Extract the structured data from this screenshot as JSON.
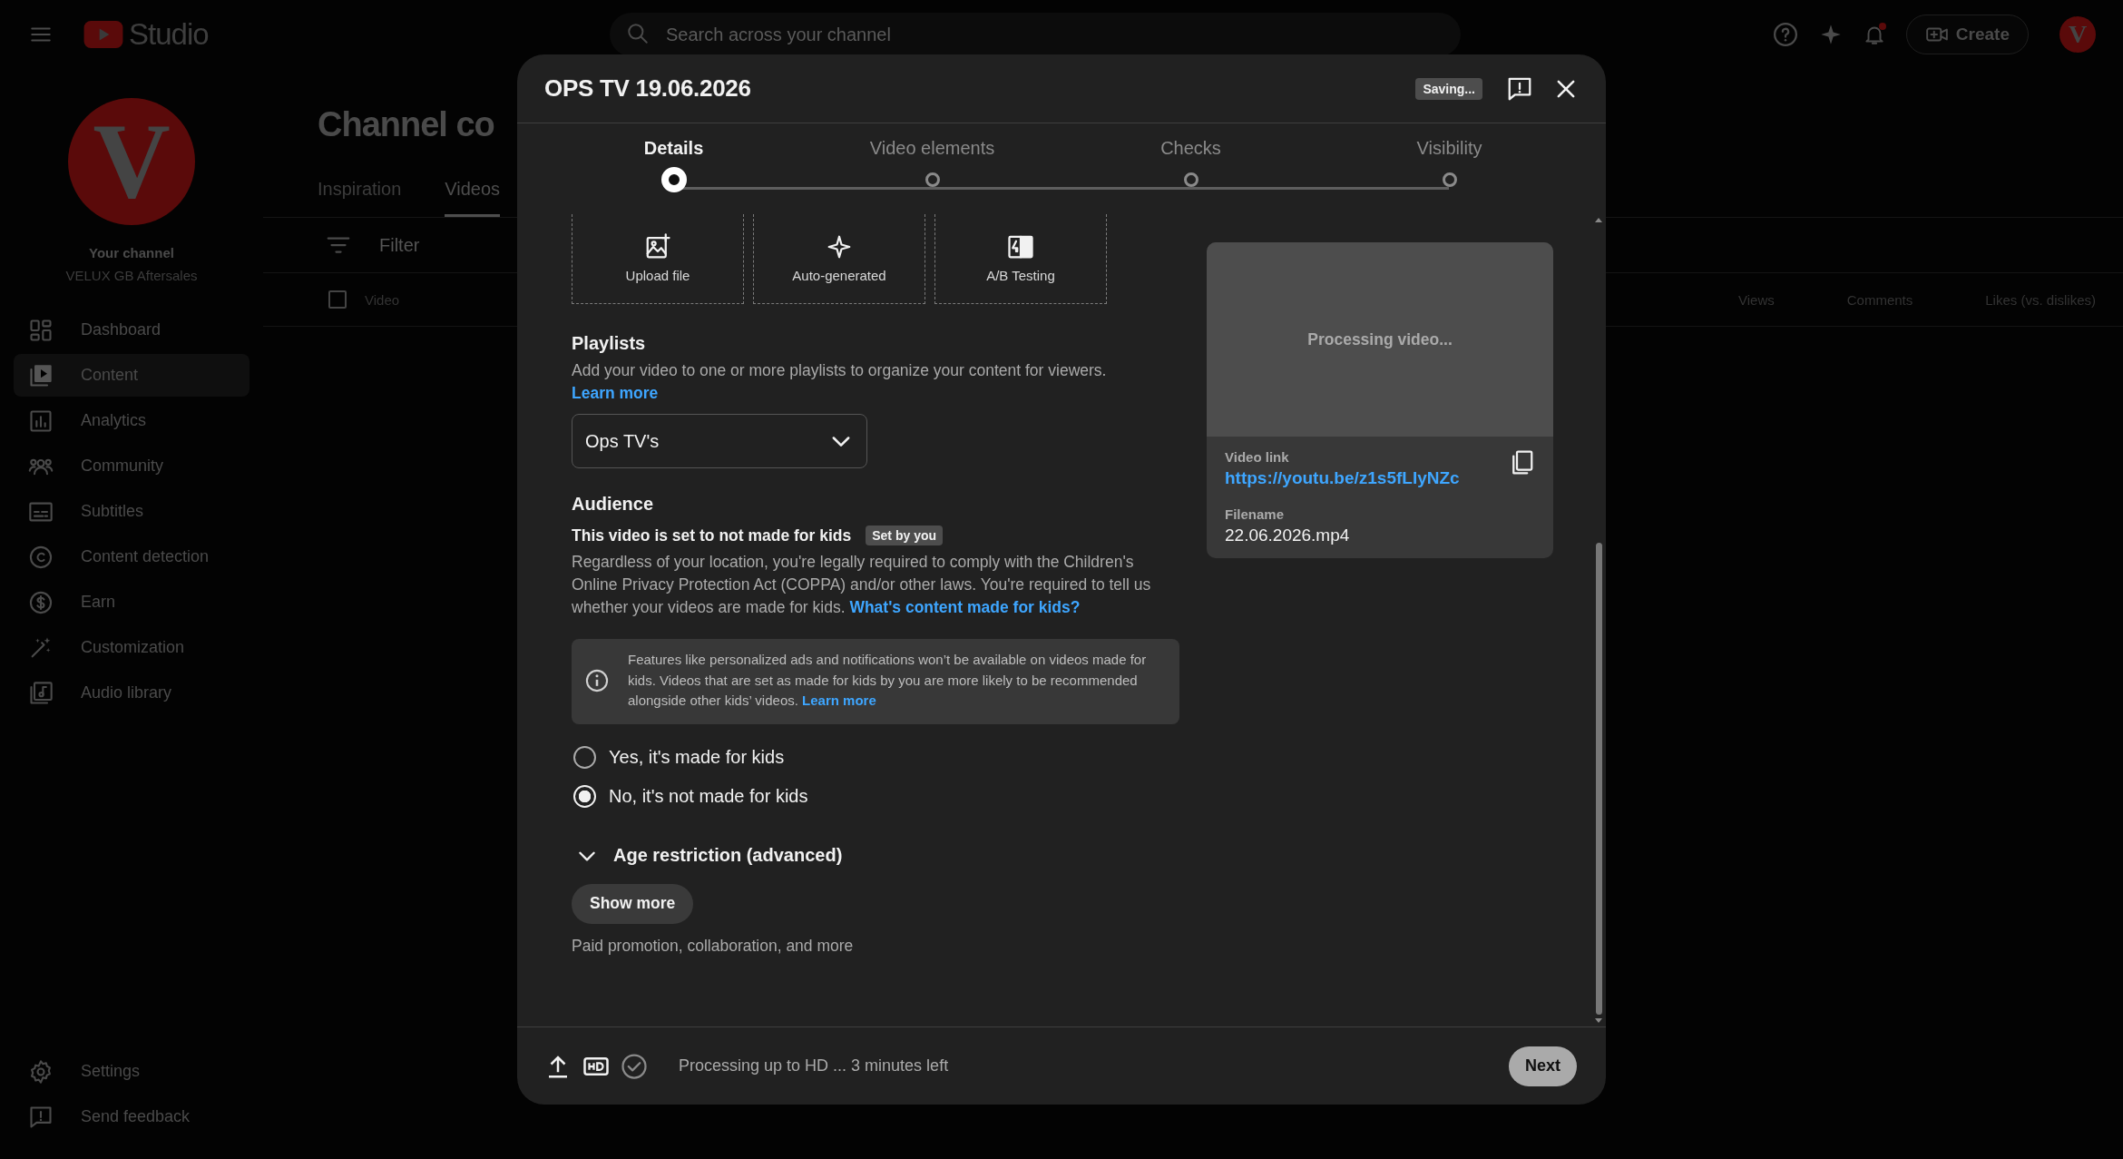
{
  "app": {
    "logo": "Studio",
    "search": {
      "placeholder": "Search across your channel"
    },
    "create_button": "Create",
    "avatar": "V"
  },
  "sidebar": {
    "avatar": "V",
    "channel_label": "Your channel",
    "channel_name": "VELUX GB Aftersales",
    "items": [
      {
        "label": "Dashboard",
        "selected": false
      },
      {
        "label": "Content",
        "selected": true
      },
      {
        "label": "Analytics",
        "selected": false
      },
      {
        "label": "Community",
        "selected": false
      },
      {
        "label": "Subtitles",
        "selected": false
      },
      {
        "label": "Content detection",
        "selected": false
      },
      {
        "label": "Earn",
        "selected": false
      },
      {
        "label": "Customization",
        "selected": false
      },
      {
        "label": "Audio library",
        "selected": false
      }
    ],
    "footer_items": [
      {
        "label": "Settings"
      },
      {
        "label": "Send feedback"
      }
    ]
  },
  "page": {
    "title": "Channel co",
    "tabs": [
      {
        "label": "Inspiration",
        "selected": false
      },
      {
        "label": "Videos",
        "selected": true
      }
    ],
    "filter": {
      "placeholder": "Filter"
    },
    "select_all": {
      "checked": false
    },
    "columns": [
      "Video",
      "Views",
      "Comments",
      "Likes (vs. dislikes)"
    ]
  },
  "dialog": {
    "title": "OPS TV 19.06.2026",
    "status_badge": "Saving...",
    "steps": [
      {
        "label": "Details",
        "selected": true
      },
      {
        "label": "Video elements",
        "selected": false
      },
      {
        "label": "Checks",
        "selected": false
      },
      {
        "label": "Visibility",
        "selected": false
      }
    ],
    "thumbnail_options": [
      {
        "label": "Upload file"
      },
      {
        "label": "Auto-generated"
      },
      {
        "label": "A/B Testing"
      }
    ],
    "playlists": {
      "heading": "Playlists",
      "description": "Add your video to one or more playlists to organize your content for viewers.",
      "link": "Learn more",
      "value": "Ops TV's"
    },
    "audience": {
      "heading": "Audience",
      "status": "This video is set to not made for kids",
      "badge": "Set by you",
      "description": "Regardless of your location, you're legally required to comply with the Children's Online Privacy Protection Act (COPPA) and/or other laws. You're required to tell us whether your videos are made for kids.",
      "link": "What's content made for kids?",
      "notice": "Features like personalized ads and notifications won’t be available on videos made for kids. Videos that are set as made for kids by you are more likely to be recommended alongside other kids’ videos.",
      "notice_link": "Learn more",
      "options": [
        {
          "label": "Yes, it's made for kids",
          "selected": false
        },
        {
          "label": "No, it's not made for kids",
          "selected": true
        }
      ]
    },
    "age_restriction": {
      "label": "Age restriction (advanced)",
      "expanded": false
    },
    "show_more": "Show more",
    "more_hint": "Paid promotion, collaboration, and more",
    "preview": {
      "status": "Processing video...",
      "link_label": "Video link",
      "link": "https://youtu.be/z1s5fLIyNZc",
      "filename_label": "Filename",
      "filename": "22.06.2026.mp4"
    },
    "footer": {
      "status": "Processing up to HD ... 3 minutes left",
      "next": "Next"
    }
  }
}
